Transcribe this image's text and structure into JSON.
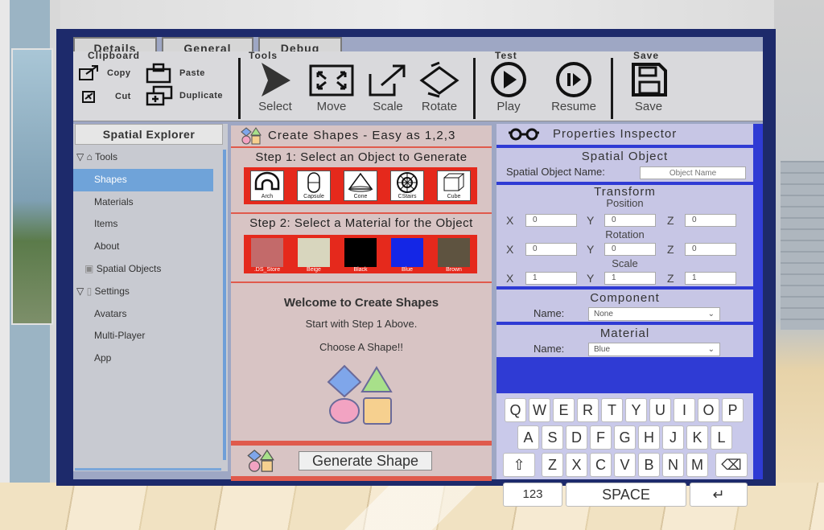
{
  "tabs": [
    "Details",
    "General",
    "Debug"
  ],
  "toolbar": {
    "clipboard_title": "Clipboard",
    "tools_title": "Tools",
    "test_title": "Test",
    "save_title": "Save",
    "copy": "Copy",
    "paste": "Paste",
    "cut": "Cut",
    "duplicate": "Duplicate",
    "select": "Select",
    "move": "Move",
    "scale": "Scale",
    "rotate": "Rotate",
    "play": "Play",
    "resume": "Resume",
    "save": "Save"
  },
  "sidebar": {
    "title": "Spatial Explorer",
    "items": [
      "Tools",
      "Shapes",
      "Materials",
      "Items",
      "About",
      "Spatial Objects",
      "Settings",
      "Avatars",
      "Multi-Player",
      "App"
    ]
  },
  "center": {
    "title": "Create  Shapes - Easy as 1,2,3",
    "step1": "Step 1: Select an Object to Generate",
    "step2": "Step 2: Select a Material for the Object",
    "shapes": [
      "Arch",
      "Capsule",
      "Cone",
      "CStairs",
      "Cube"
    ],
    "materials": [
      {
        "name": ".DS_Store",
        "color": "#c36a6a"
      },
      {
        "name": "Beige",
        "color": "#d8d6be"
      },
      {
        "name": "Black",
        "color": "#000000"
      },
      {
        "name": "Blue",
        "color": "#1426e6"
      },
      {
        "name": "Brown",
        "color": "#5e5340"
      }
    ],
    "welcome_title": "Welcome to Create Shapes",
    "welcome_line1": "Start with Step 1 Above.",
    "welcome_line2": "Choose A Shape!!",
    "generate": "Generate Shape"
  },
  "inspector": {
    "title": "Properties Inspector",
    "spatial_object": "Spatial Object",
    "object_name_label": "Spatial Object Name:",
    "object_name_placeholder": "Object Name",
    "transform": "Transform",
    "position": "Position",
    "rotation": "Rotation",
    "scale": "Scale",
    "x": "X",
    "y": "Y",
    "z": "Z",
    "pos": [
      "0",
      "0",
      "0"
    ],
    "rot": [
      "0",
      "0",
      "0"
    ],
    "scl": [
      "1",
      "1",
      "1"
    ],
    "component": "Component",
    "name_label": "Name:",
    "component_value": "None",
    "material": "Material",
    "material_value": "Blue"
  },
  "keyboard": {
    "row1": [
      "Q",
      "W",
      "E",
      "R",
      "T",
      "Y",
      "U",
      "I",
      "O",
      "P"
    ],
    "row2": [
      "A",
      "S",
      "D",
      "F",
      "G",
      "H",
      "J",
      "K",
      "L"
    ],
    "row3": [
      "Z",
      "X",
      "C",
      "V",
      "B",
      "N",
      "M"
    ],
    "num": "123",
    "space": "SPACE"
  }
}
